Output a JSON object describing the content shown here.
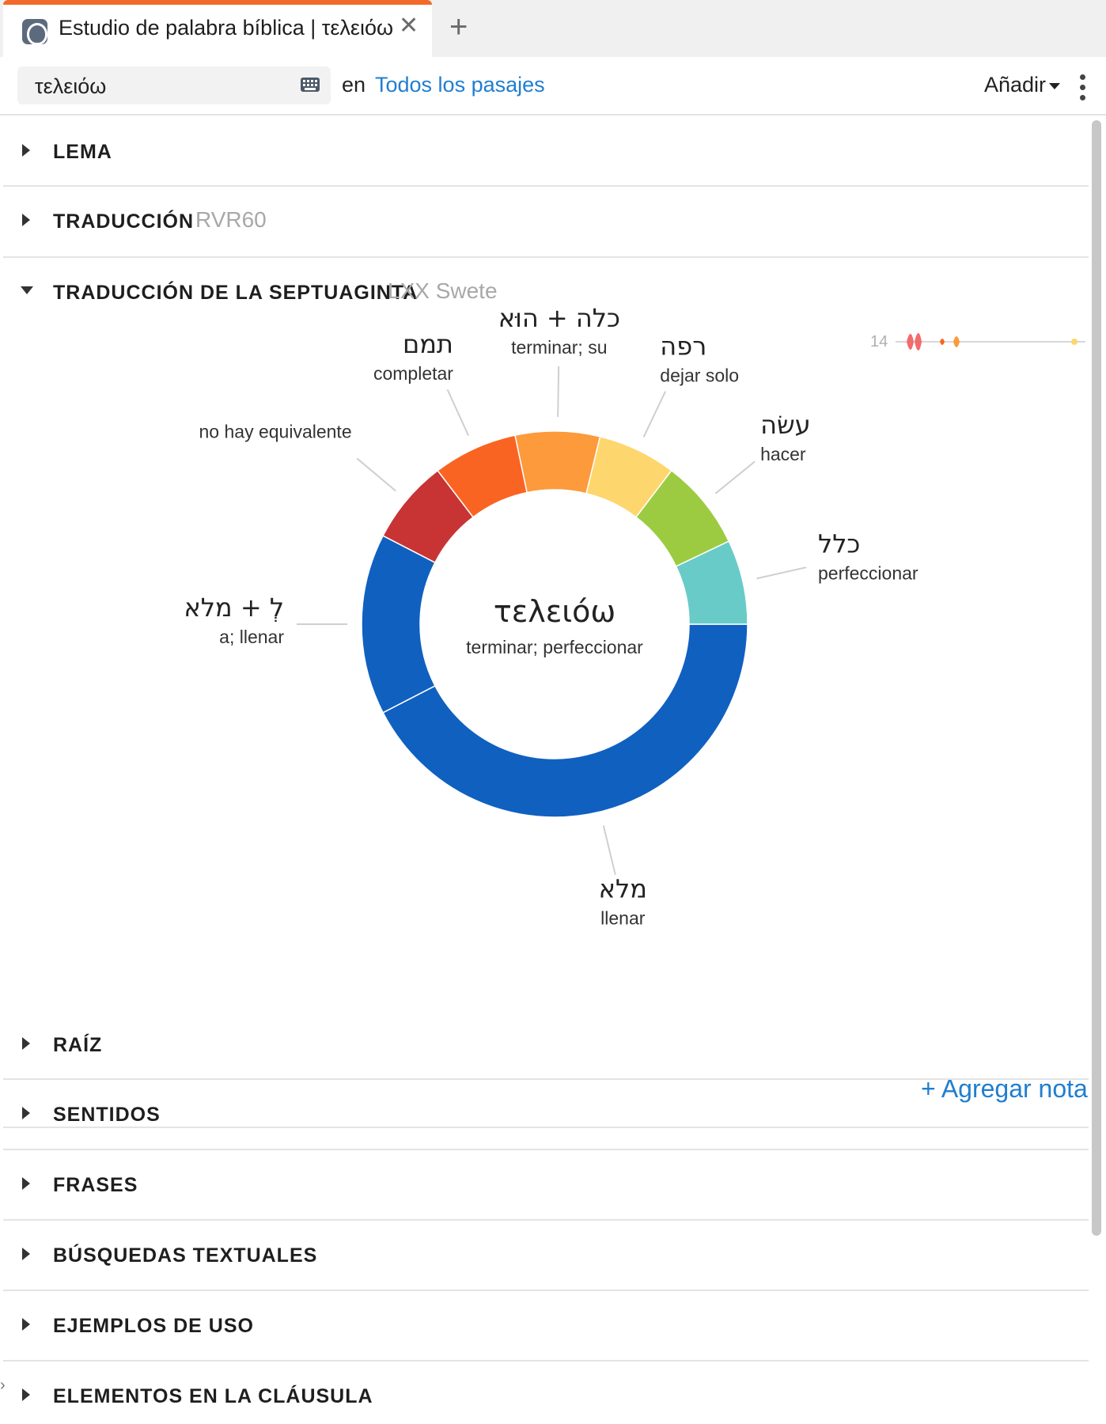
{
  "tab": {
    "title": "Estudio de palabra bíblica | τελειόω",
    "close": "✕",
    "add": "+"
  },
  "search": {
    "value": "τελειόω",
    "in_label": "en",
    "scope": "Todos los pasajes",
    "add_menu": "Añadir"
  },
  "sections": {
    "lema": "LEMA",
    "traduccion": {
      "title": "TRADUCCIÓN",
      "version": "RVR60"
    },
    "septuaginta": {
      "title": "TRADUCCIÓN DE LA SEPTUAGINTA",
      "version": "LXX Swete"
    },
    "raiz": "RAÍZ",
    "sentidos": "SENTIDOS",
    "frases": "FRASES",
    "busquedas": "BÚSQUEDAS TEXTUALES",
    "ejemplos": "EJEMPLOS DE USO",
    "elementos": "ELEMENTOS EN LA CLÁUSULA"
  },
  "note": {
    "add_label": "+ Agregar nota"
  },
  "mini_timeline": {
    "label": "14"
  },
  "chart_data": {
    "type": "pie",
    "variant": "donut",
    "center": {
      "word": "τελειόω",
      "gloss": "terminar; perfeccionar"
    },
    "slices": [
      {
        "word": "מלא",
        "gloss": "llenar",
        "value": 42,
        "color": "#1060c0"
      },
      {
        "word": "לְ + מלא",
        "gloss": "a; llenar",
        "value": 15,
        "color": "#1060c0"
      },
      {
        "word": "",
        "gloss": "no hay equivalente",
        "value": 7,
        "color": "#c83434"
      },
      {
        "word": "תמם",
        "gloss": "completar",
        "value": 7,
        "color": "#fa6422"
      },
      {
        "word": "כלה + הוּא",
        "gloss": "terminar; su",
        "value": 7,
        "color": "#fc9a3c"
      },
      {
        "word": "רפה",
        "gloss": "dejar solo",
        "value": 6.5,
        "color": "#fdd66e"
      },
      {
        "word": "עשׂה",
        "gloss": "hacer",
        "value": 7.5,
        "color": "#9ccb42"
      },
      {
        "word": "כלל",
        "gloss": "perfeccionar",
        "value": 7,
        "color": "#68cbc8"
      }
    ]
  }
}
